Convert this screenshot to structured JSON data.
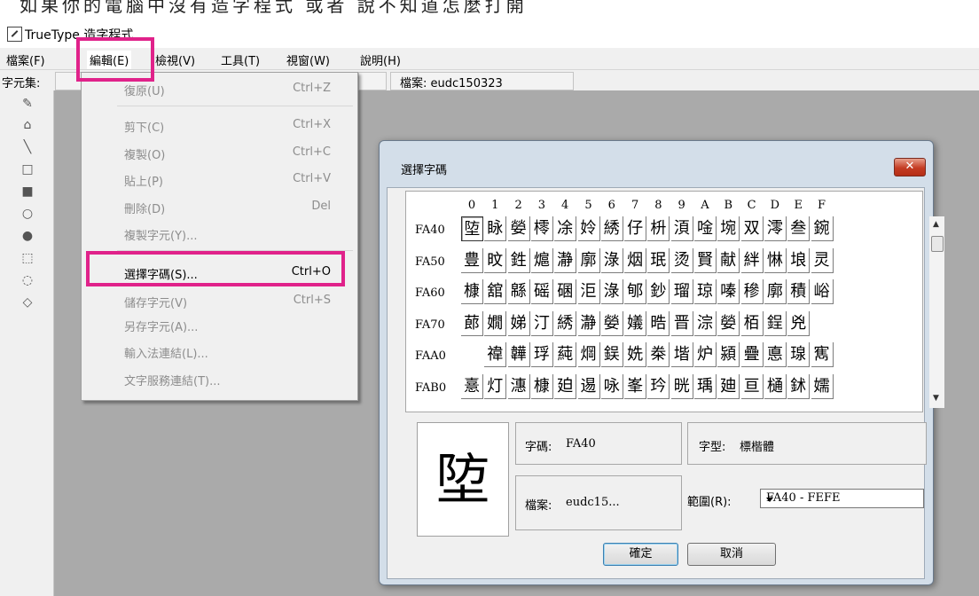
{
  "caption_fragment": "如果你的電腦中沒有造字程式 或者 說不知道怎麼打開",
  "window": {
    "title": "TrueType 造字程式"
  },
  "menubar": [
    {
      "label": "檔案(F)"
    },
    {
      "label": "編輯(E)"
    },
    {
      "label": "檢視(V)"
    },
    {
      "label": "工具(T)"
    },
    {
      "label": "視窗(W)"
    },
    {
      "label": "說明(H)"
    }
  ],
  "status": {
    "charset_label": "字元集:",
    "file_label": "檔案: eudc150323"
  },
  "edit_menu": [
    {
      "label": "復原(U)",
      "shortcut": "Ctrl+Z"
    },
    {
      "label": "剪下(C)",
      "shortcut": "Ctrl+X"
    },
    {
      "label": "複製(O)",
      "shortcut": "Ctrl+C"
    },
    {
      "label": "貼上(P)",
      "shortcut": "Ctrl+V"
    },
    {
      "label": "刪除(D)",
      "shortcut": "Del"
    },
    {
      "label": "複製字元(Y)...",
      "shortcut": ""
    },
    {
      "label": "選擇字碼(S)...",
      "shortcut": "Ctrl+O"
    },
    {
      "label": "儲存字元(V)",
      "shortcut": "Ctrl+S"
    },
    {
      "label": "另存字元(A)...",
      "shortcut": ""
    },
    {
      "label": "輸入法連結(L)...",
      "shortcut": ""
    },
    {
      "label": "文字服務連結(T)...",
      "shortcut": ""
    }
  ],
  "dialog": {
    "title": "選擇字碼",
    "close": "✕",
    "columns": [
      "0",
      "1",
      "2",
      "3",
      "4",
      "5",
      "6",
      "7",
      "8",
      "9",
      "A",
      "B",
      "C",
      "D",
      "E",
      "F"
    ],
    "rows": [
      {
        "code": "FA40",
        "chars": [
          "埅",
          "眿",
          "嫈",
          "㯪",
          "凃",
          "姈",
          "綉",
          "仔",
          "枡",
          "湏",
          "唫",
          "埦",
          "双",
          "澪",
          "叁",
          "鋺"
        ]
      },
      {
        "code": "FA50",
        "chars": [
          "豊",
          "旼",
          "鉎",
          "熩",
          "瀞",
          "廓",
          "淥",
          "烟",
          "珉",
          "烫",
          "賢",
          "献",
          "絆",
          "惏",
          "埌",
          "灵"
        ]
      },
      {
        "code": "FA60",
        "chars": [
          "槺",
          "舘",
          "緜",
          "磘",
          "碅",
          "洰",
          "淥",
          "郇",
          "鈔",
          "瑠",
          "琼",
          "嗪",
          "穇",
          "廓",
          "積",
          "峪"
        ]
      },
      {
        "code": "FA70",
        "chars": [
          "蓈",
          "嫺",
          "娣",
          "汀",
          "綉",
          "瀞",
          "嫈",
          "嬟",
          "晧",
          "晋",
          "淙",
          "嫈",
          "栢",
          "鋥",
          "兇",
          ""
        ]
      },
      {
        "code": "FAA0",
        "chars": [
          "",
          "禕",
          "韡",
          "琈",
          "蒓",
          "焵",
          "鋘",
          "姺",
          "桊",
          "堦",
          "炉",
          "潁",
          "疊",
          "悳",
          "瑔",
          "寯"
        ]
      },
      {
        "code": "FAB0",
        "chars": [
          "憙",
          "灯",
          "潓",
          "槺",
          "廹",
          "逷",
          "咏",
          "峯",
          "玪",
          "晄",
          "瑀",
          "廸",
          "亘",
          "樋",
          "鉥",
          "嬬"
        ]
      }
    ],
    "preview_char": "埅",
    "code_label": "字碼:",
    "code_value": "FA40",
    "font_label": "字型:",
    "font_value": "標楷體",
    "file_label": "檔案:",
    "file_value": "eudc15...",
    "range_label": "範圍(R):",
    "range_value": "FA40 - FEFE",
    "ok_label": "確定",
    "cancel_label": "取消"
  },
  "colors": {
    "highlight": "#e0228a",
    "workspace": "#aaaaaa",
    "dialog_frame": "#d3dee9"
  }
}
